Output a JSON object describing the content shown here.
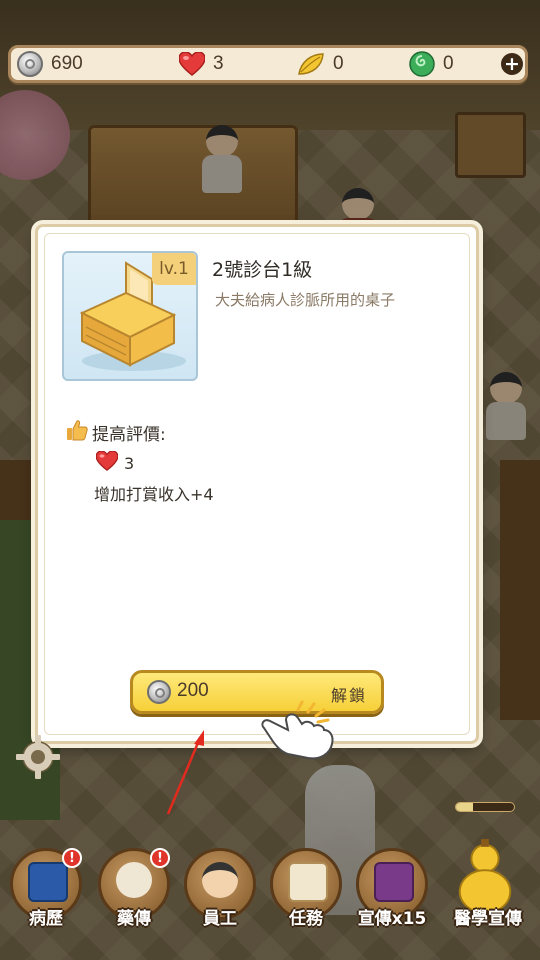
{
  "resources": {
    "coins": "690",
    "hearts": "3",
    "leaves": "0",
    "jade": "0"
  },
  "dialog": {
    "level": "lv.1",
    "title": "2號診台1級",
    "description": "大夫給病人診脈所用的桌子",
    "improve_label": "提高評價:",
    "rating_value": "3",
    "tip_bonus": "增加打賞收入+4",
    "unlock_cost": "200",
    "unlock_label": "解鎖"
  },
  "bottom_nav": [
    {
      "label": "病歷",
      "icon": "book-icon",
      "alert": "!"
    },
    {
      "label": "藥傳",
      "icon": "herb-bowl-icon",
      "alert": "!"
    },
    {
      "label": "員工",
      "icon": "staff-icon",
      "alert": ""
    },
    {
      "label": "任務",
      "icon": "scroll-icon",
      "alert": ""
    },
    {
      "label": "宣傳x15",
      "icon": "flag-icon",
      "alert": ""
    },
    {
      "label": "醫學宣傳",
      "icon": "gourd-icon",
      "alert": ""
    }
  ],
  "progress": {
    "fraction": 0.3
  },
  "colors": {
    "panel_border": "#dccba4",
    "button_yellow": "#f6d039",
    "heart_red": "#e53a3a",
    "jade_green": "#3cae5a"
  }
}
